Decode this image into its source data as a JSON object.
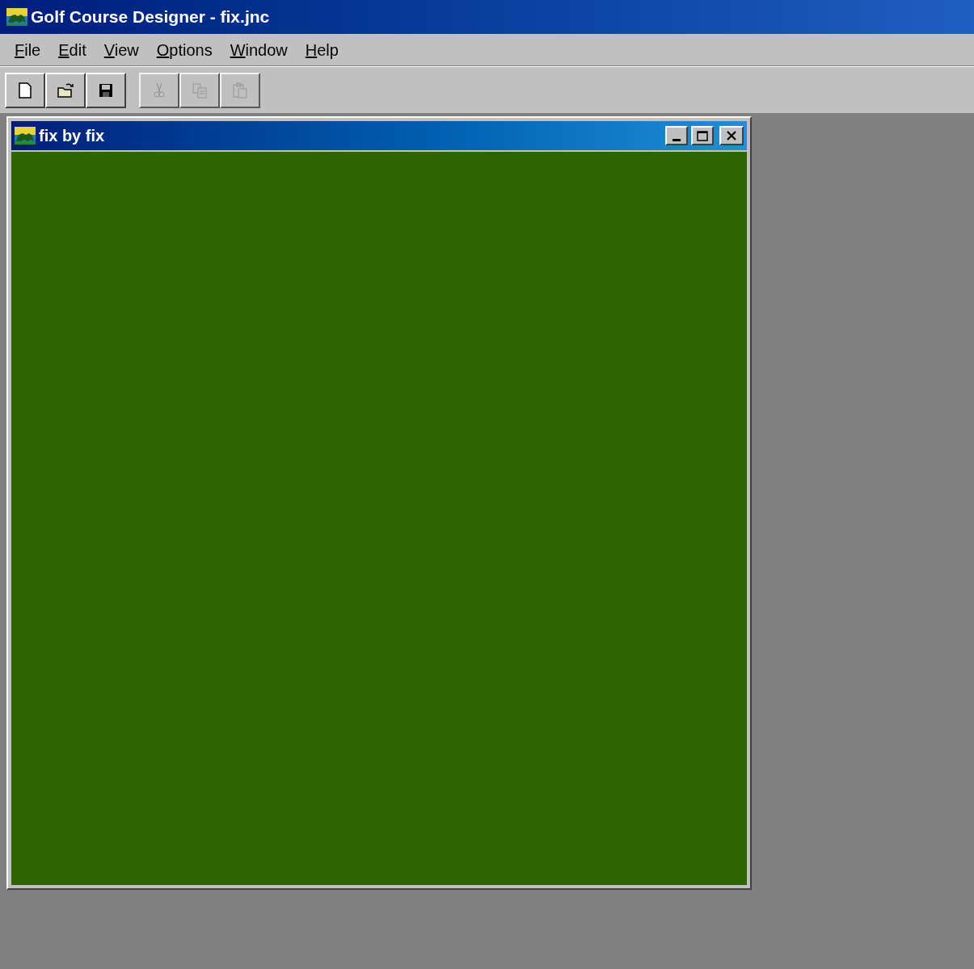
{
  "window": {
    "title": "Golf Course Designer - fix.jnc"
  },
  "menu": [
    {
      "label": "File",
      "mnemonic": true
    },
    {
      "label": "Edit",
      "mnemonic": true
    },
    {
      "label": "View",
      "mnemonic": true
    },
    {
      "label": "Options",
      "mnemonic": true
    },
    {
      "label": "Window",
      "mnemonic": true
    },
    {
      "label": "Help",
      "mnemonic": true
    }
  ],
  "toolbar": [
    {
      "kind": "new",
      "disabled": false
    },
    {
      "kind": "open",
      "disabled": false
    },
    {
      "kind": "save",
      "disabled": false
    },
    {
      "kind": "cut",
      "disabled": true
    },
    {
      "kind": "copy",
      "disabled": true
    },
    {
      "kind": "paste",
      "disabled": true
    }
  ],
  "child_window": {
    "title": "fix by fix",
    "active": true
  }
}
